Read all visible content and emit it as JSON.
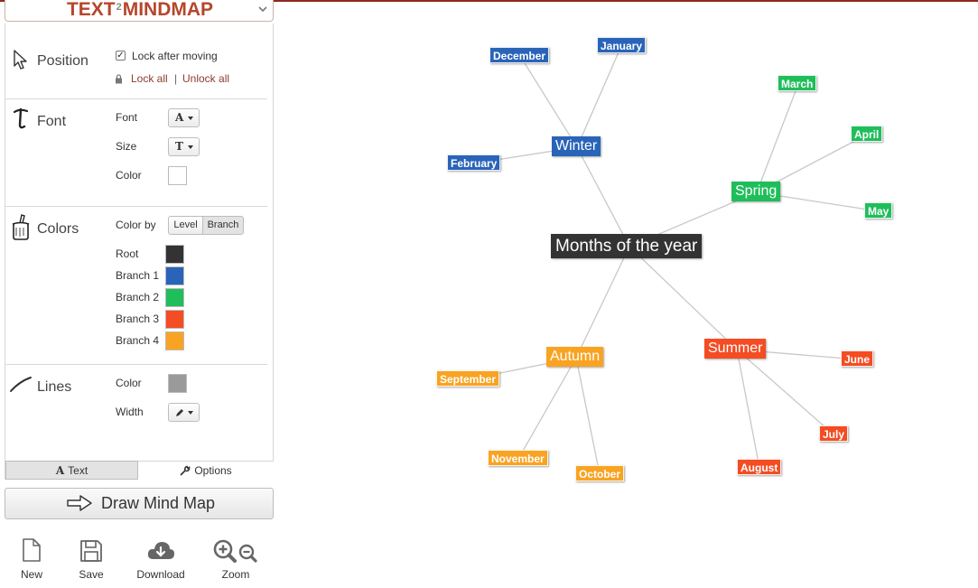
{
  "app": {
    "logo_left": "TEXT",
    "logo_mid": "2",
    "logo_right": "MINDMAP"
  },
  "position": {
    "title": "Position",
    "lock_after_moving_label": "Lock after moving",
    "lock_after_moving_checked": true,
    "lock_all": "Lock all",
    "separator": "|",
    "unlock_all": "Unlock all"
  },
  "font": {
    "title": "Font",
    "font_label": "Font",
    "size_label": "Size",
    "color_label": "Color",
    "font_glyph": "A",
    "size_glyph": "T",
    "color_value": "#ffffff"
  },
  "colors": {
    "title": "Colors",
    "color_by_label": "Color by",
    "level_label": "Level",
    "branch_label": "Branch",
    "items": [
      {
        "label": "Root",
        "color": "#333333"
      },
      {
        "label": "Branch 1",
        "color": "#2a64b8"
      },
      {
        "label": "Branch 2",
        "color": "#1fbe5b"
      },
      {
        "label": "Branch 3",
        "color": "#f44c23"
      },
      {
        "label": "Branch 4",
        "color": "#f9a322"
      }
    ]
  },
  "lines": {
    "title": "Lines",
    "color_label": "Color",
    "width_label": "Width",
    "color_value": "#9a9a9a"
  },
  "tabs": {
    "text": "Text",
    "options": "Options"
  },
  "draw_button": "Draw Mind Map",
  "toolbar": {
    "new": "New",
    "save": "Save",
    "download": "Download",
    "zoom": "Zoom"
  },
  "mindmap": {
    "root": "Months of the year",
    "winter": "Winter",
    "spring": "Spring",
    "summer": "Summer",
    "autumn": "Autumn",
    "december": "December",
    "january": "January",
    "february": "February",
    "march": "March",
    "april": "April",
    "may": "May",
    "june": "June",
    "july": "July",
    "august": "August",
    "september": "September",
    "october": "October",
    "november": "November",
    "line_color": "#c8c8c8"
  }
}
